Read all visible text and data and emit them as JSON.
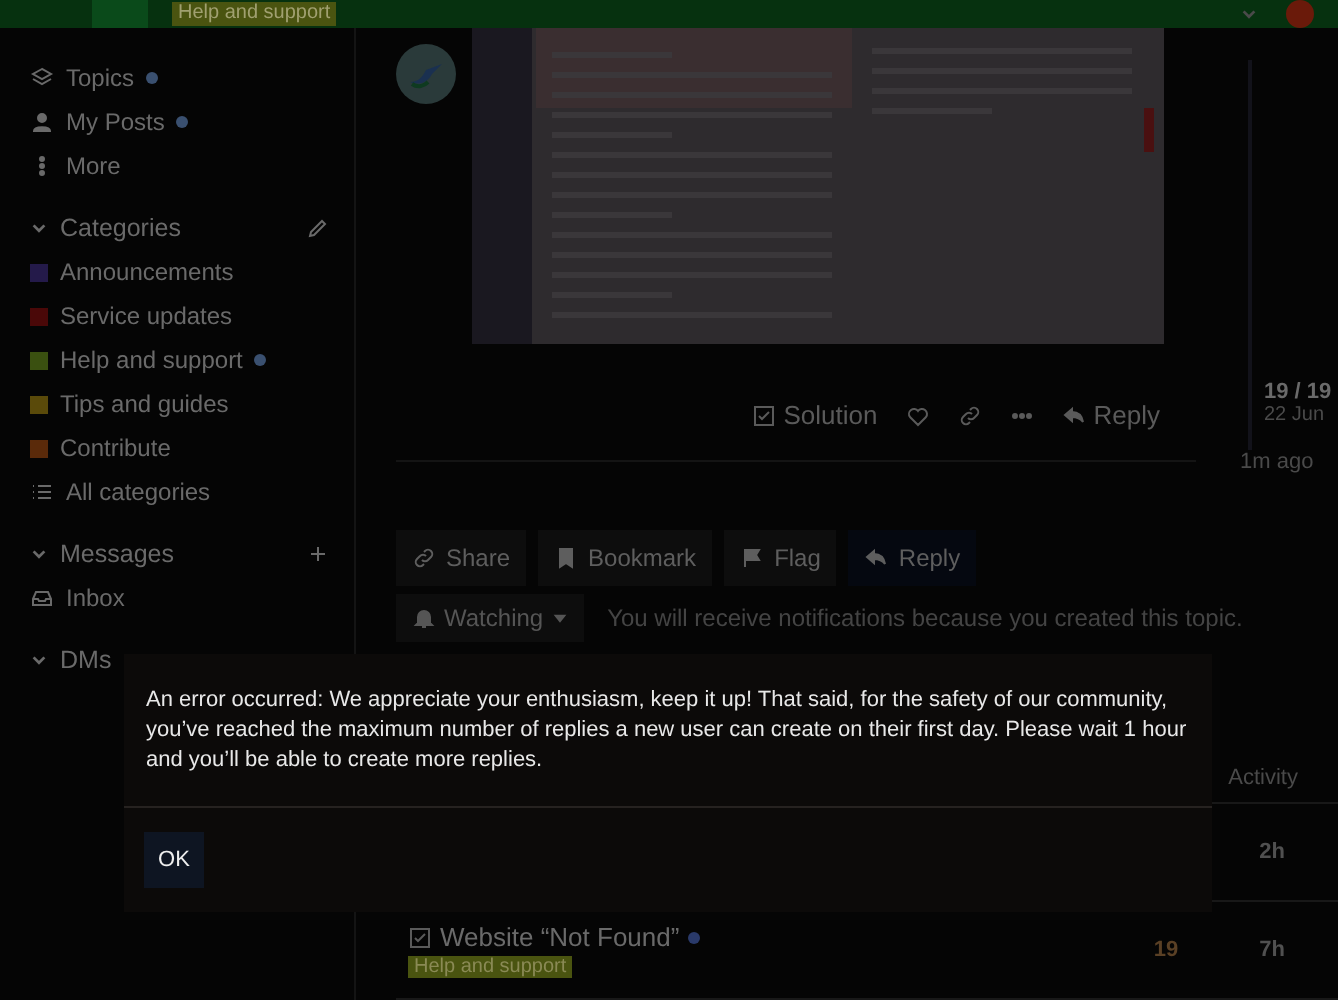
{
  "header": {
    "category_badge": "Help and support"
  },
  "sidebar": {
    "items": [
      {
        "label": "Topics",
        "unread": true
      },
      {
        "label": "My Posts",
        "unread": true
      },
      {
        "label": "More",
        "unread": false
      }
    ],
    "sections": [
      {
        "title": "Categories",
        "items": [
          {
            "label": "Announcements",
            "color": "#241a4a",
            "unread": false
          },
          {
            "label": "Service updates",
            "color": "#4a0808",
            "unread": false
          },
          {
            "label": "Help and support",
            "color": "#3a5010",
            "unread": true
          },
          {
            "label": "Tips and guides",
            "color": "#5a4a0a",
            "unread": false
          },
          {
            "label": "Contribute",
            "color": "#5a2a0a",
            "unread": false
          },
          {
            "label": "All categories",
            "unread": false
          }
        ]
      },
      {
        "title": "Messages",
        "items": [
          {
            "label": "Inbox",
            "unread": false
          }
        ]
      },
      {
        "title": "DMs"
      }
    ]
  },
  "post": {
    "actions": [
      "Solution",
      "Reply"
    ]
  },
  "timeline": {
    "position": "19 / 19",
    "date": "22 Jun",
    "age": "1m ago"
  },
  "topic_buttons": [
    "Share",
    "Bookmark",
    "Flag",
    "Reply"
  ],
  "notifications": {
    "level": "Watching",
    "description": "You will receive notifications because you created this topic."
  },
  "topic_list": {
    "columns": [
      "Activity"
    ],
    "rows": [
      {
        "activity": "2h"
      },
      {
        "title": "Website “Not Found”",
        "tag": "Help and support",
        "replies": "19",
        "activity": "7h",
        "unread": true
      }
    ]
  },
  "dialog": {
    "message": "An error occurred: We appreciate your enthusiasm, keep it up! That said, for the safety of our community, you’ve reached the maximum number of replies a new user can create on their first day. Please wait 1 hour and you’ll be able to create more replies.",
    "button": "OK"
  }
}
